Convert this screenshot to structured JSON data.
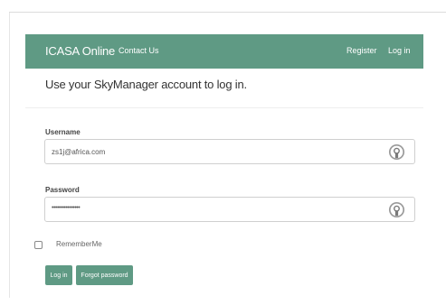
{
  "navbar": {
    "brand": "ICASA Online",
    "contact": "Contact Us",
    "register": "Register",
    "login": "Log in"
  },
  "form": {
    "heading": "Use your SkyManager account to log in.",
    "username_label": "Username",
    "username_value": "zs1j@africa.com",
    "password_label": "Password",
    "password_mask": "••••••••••••••••",
    "field_icon": "user-circle-icon",
    "remember_label": "RememberMe",
    "login_button": "Log in",
    "forgot_button": "Forgot password"
  },
  "colors": {
    "accent": "#5f9a84",
    "text": "#333333",
    "border": "#cfcfcf"
  }
}
